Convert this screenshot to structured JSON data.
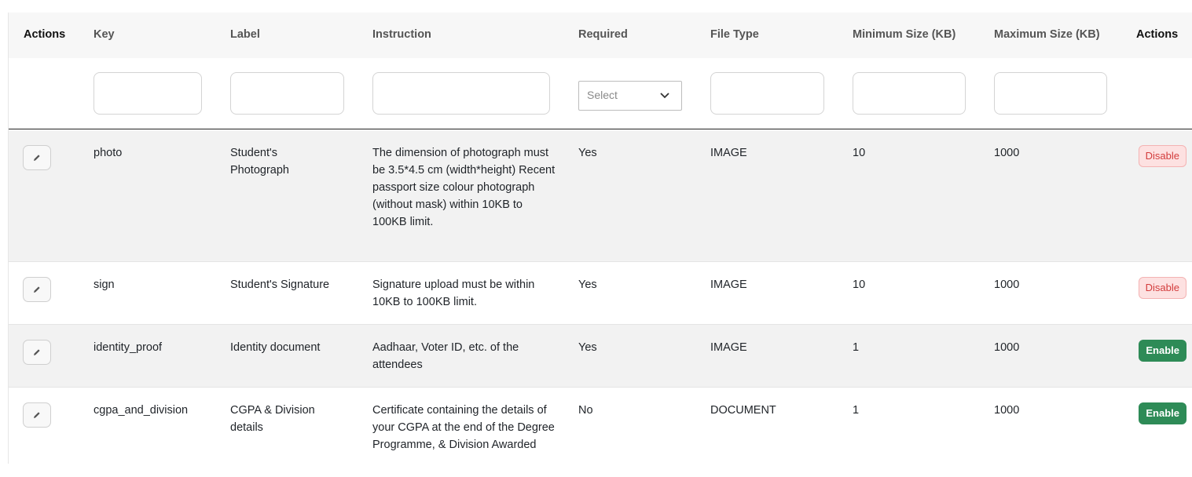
{
  "header": {
    "actions_left": "Actions",
    "key": "Key",
    "label": "Label",
    "instruction": "Instruction",
    "required": "Required",
    "file_type": "File Type",
    "min_size": "Minimum Size (KB)",
    "max_size": "Maximum Size (KB)",
    "actions_right": "Actions"
  },
  "filters": {
    "required_placeholder": "Select"
  },
  "rows": [
    {
      "key": "photo",
      "label": "Student's Photograph",
      "instruction": "The dimension of photograph must be 3.5*4.5 cm (width*height) Recent passport size colour photograph (without mask) within 10KB to 100KB limit.",
      "required": "Yes",
      "file_type": "IMAGE",
      "min_size": "10",
      "max_size": "1000",
      "status_action": "Disable"
    },
    {
      "key": "sign",
      "label": "Student's Signature",
      "instruction": "Signature upload must be within 10KB to 100KB limit.",
      "required": "Yes",
      "file_type": "IMAGE",
      "min_size": "10",
      "max_size": "1000",
      "status_action": "Disable"
    },
    {
      "key": "identity_proof",
      "label": "Identity document",
      "instruction": "Aadhaar, Voter ID, etc. of the attendees",
      "required": "Yes",
      "file_type": "IMAGE",
      "min_size": "1",
      "max_size": "1000",
      "status_action": "Enable"
    },
    {
      "key": "cgpa_and_division",
      "label": "CGPA & Division details",
      "instruction": "Certificate containing the details of your CGPA at the end of the Degree Programme, & Division Awarded",
      "required": "No",
      "file_type": "DOCUMENT",
      "min_size": "1",
      "max_size": "1000",
      "status_action": "Enable"
    }
  ],
  "icons": {
    "edit": "pencil-icon",
    "dropdown": "chevron-down-icon"
  },
  "colors": {
    "disable_bg": "#fde1e1",
    "disable_text": "#d33c3c",
    "enable_bg": "#2e8b57",
    "shaded_row": "#f2f2f2"
  }
}
